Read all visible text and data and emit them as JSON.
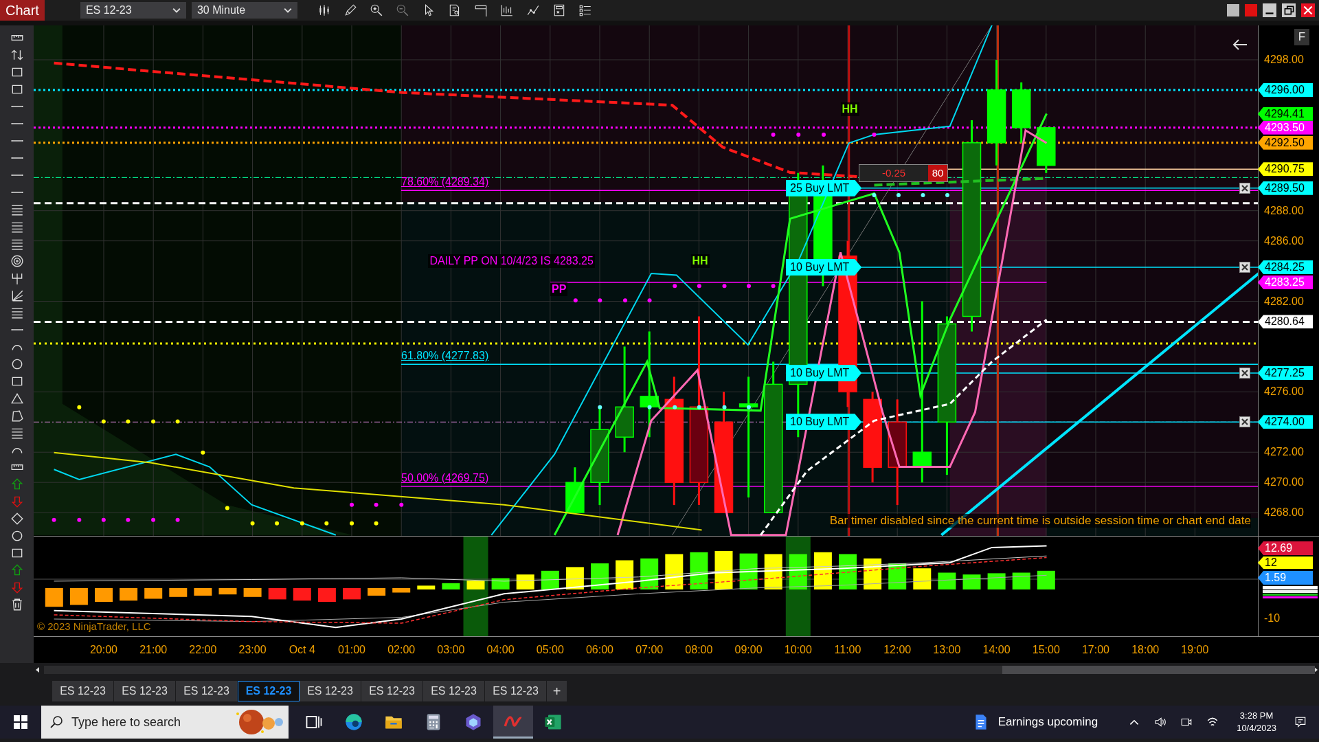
{
  "window": {
    "title": "Chart"
  },
  "toolbar": {
    "instrument": "ES 12-23",
    "interval": "30 Minute"
  },
  "chart": {
    "corner_button": "F",
    "price_ticks": [
      "4298.00",
      "4288.00",
      "4286.00",
      "4282.00",
      "4276.00",
      "4272.00",
      "4270.00",
      "4268.00"
    ],
    "price_flags": [
      {
        "label": "4296.00",
        "color": "#00ffff"
      },
      {
        "label": "4294.41",
        "color": "#00ff00"
      },
      {
        "label": "4293.50",
        "color": "#ff00ff"
      },
      {
        "label": "4292.50",
        "color": "#ffa500"
      },
      {
        "label": "4290.75",
        "color": "#ffff00"
      },
      {
        "label": "4289.50",
        "color": "#00ffff"
      },
      {
        "label": "4284.25",
        "color": "#00ffff"
      },
      {
        "label": "4283.25",
        "color": "#ff00ff"
      },
      {
        "label": "4280.64",
        "color": "#ffffff"
      },
      {
        "label": "4277.25",
        "color": "#00ffff"
      },
      {
        "label": "4274.00",
        "color": "#00ffff"
      }
    ],
    "orders": [
      {
        "label": "25 Buy LMT"
      },
      {
        "label": "10 Buy LMT"
      },
      {
        "label": "10 Buy LMT"
      },
      {
        "label": "10 Buy LMT"
      }
    ],
    "fib_labels": [
      "78.60% (4289.34)",
      "61.80% (4277.83)",
      "50.00% (4269.75)"
    ],
    "annotations": [
      "HH",
      "HH",
      "PP",
      "DAILY PP ON 10/4/23 IS 4283.25"
    ],
    "position": {
      "pnl": "-0.25",
      "quantity": "80"
    },
    "message": "Bar timer disabled since the current time is outside session time or chart end date"
  },
  "indicator": {
    "copyright": "© 2023 NinjaTrader, LLC",
    "flags": [
      {
        "label": "12.69",
        "color": "#dc143c"
      },
      {
        "label": "12",
        "color": "#ffff00"
      },
      {
        "label": "1.59",
        "color": "#1e90ff"
      }
    ],
    "ticks": [
      "-10"
    ]
  },
  "time_axis": [
    "20:00",
    "21:00",
    "22:00",
    "23:00",
    "Oct 4",
    "01:00",
    "02:00",
    "03:00",
    "04:00",
    "05:00",
    "06:00",
    "07:00",
    "08:00",
    "09:00",
    "10:00",
    "11:00",
    "12:00",
    "13:00",
    "14:00",
    "15:00",
    "17:00",
    "18:00",
    "19:00"
  ],
  "tabs": [
    {
      "label": "ES 12-23",
      "selected": false
    },
    {
      "label": "ES 12-23",
      "selected": false
    },
    {
      "label": "ES 12-23",
      "selected": false
    },
    {
      "label": "ES 12-23",
      "selected": true
    },
    {
      "label": "ES 12-23",
      "selected": false
    },
    {
      "label": "ES 12-23",
      "selected": false
    },
    {
      "label": "ES 12-23",
      "selected": false
    },
    {
      "label": "ES 12-23",
      "selected": false
    }
  ],
  "add_tab": "+",
  "taskbar": {
    "search": {
      "placeholder": "Type here to search"
    },
    "apps": [
      {
        "kind": "taskview",
        "selected": false
      },
      {
        "kind": "edge",
        "selected": false
      },
      {
        "kind": "explorer",
        "selected": false
      },
      {
        "kind": "calculator",
        "selected": false
      },
      {
        "kind": "copilot",
        "selected": false
      },
      {
        "kind": "ninja",
        "selected": true
      },
      {
        "kind": "excel",
        "selected": false
      }
    ],
    "widget": "Earnings upcoming",
    "time": "3:28 PM",
    "date": "10/4/2023"
  }
}
